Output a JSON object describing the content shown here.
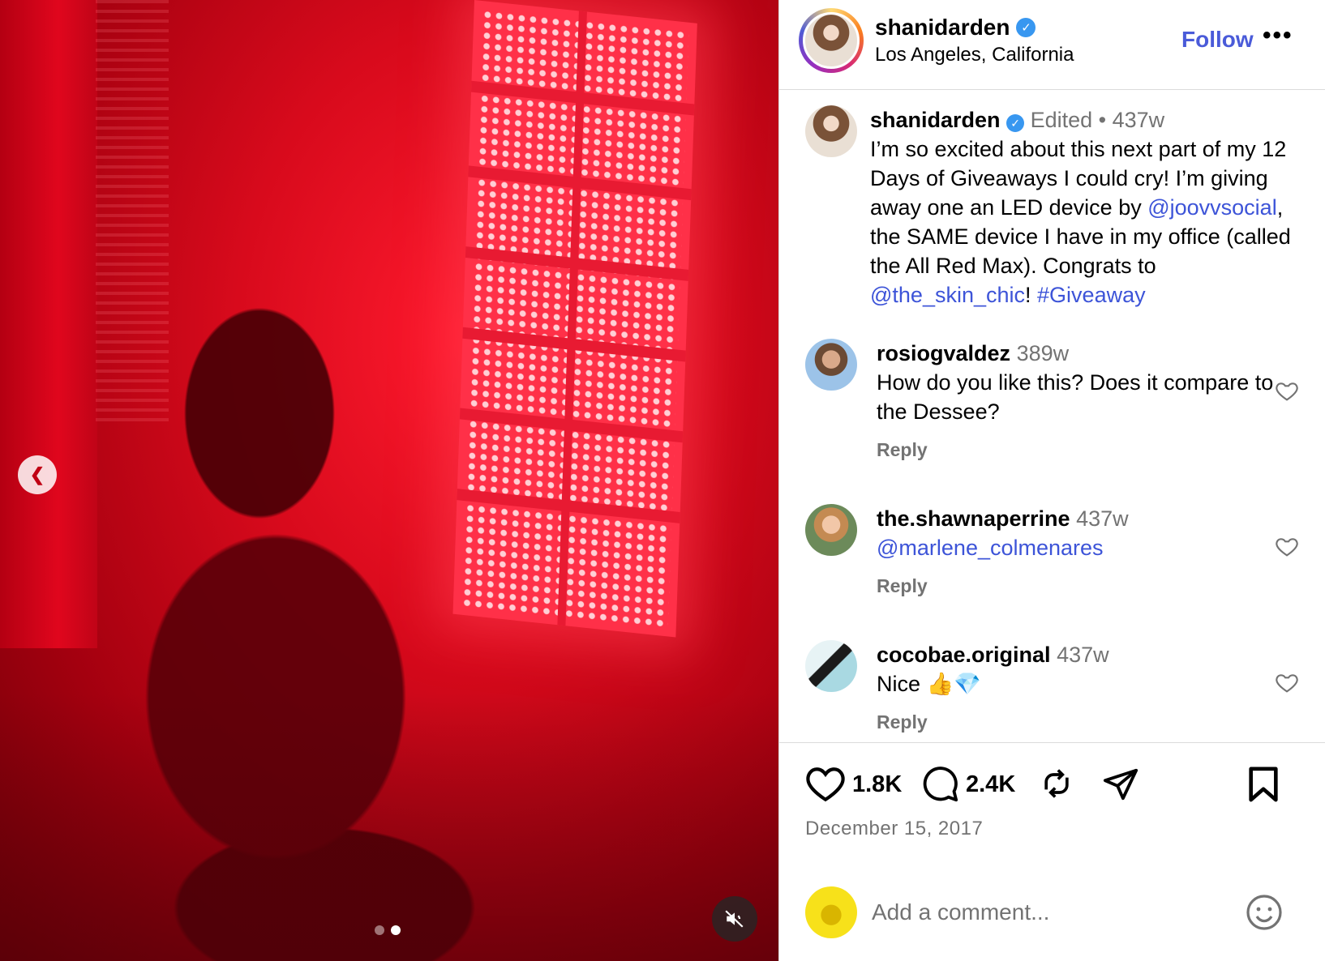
{
  "post": {
    "author": "shanidarden",
    "location": "Los Angeles, California",
    "follow_label": "Follow",
    "more_label": "•••"
  },
  "caption": {
    "user": "shanidarden",
    "edited": "Edited",
    "separator": "•",
    "time": "437w",
    "text_1": "I’m so excited about this next part of my 12 Days of Giveaways I could cry! I’m giving away one an LED device by ",
    "mention_1": "@joovvsocial",
    "text_2": ", the SAME device I have in my office (called the All Red Max). Congrats to ",
    "mention_2": "@the_skin_chic",
    "text_3": "! ",
    "hashtag": "#Giveaway"
  },
  "comments": [
    {
      "user": "rosiogvaldez",
      "time": "389w",
      "text": "How do you like this? Does it compare to the Dessee?",
      "reply": "Reply"
    },
    {
      "user": "the.shawnaperrine",
      "time": "437w",
      "mention": "@marlene_colmenares",
      "reply": "Reply"
    },
    {
      "user": "cocobae.original",
      "time": "437w",
      "text": "Nice 👍💎",
      "reply": "Reply"
    }
  ],
  "actions": {
    "likes": "1.8K",
    "comments_count": "2.4K",
    "date": "December 15, 2017"
  },
  "composer": {
    "placeholder": "Add a comment..."
  },
  "media": {
    "carousel_dots": 2,
    "active_dot": 2,
    "accent": "#d80a1c"
  },
  "colors": {
    "link": "#3d54d8",
    "verified": "#3897f0",
    "muted": "#737373"
  }
}
